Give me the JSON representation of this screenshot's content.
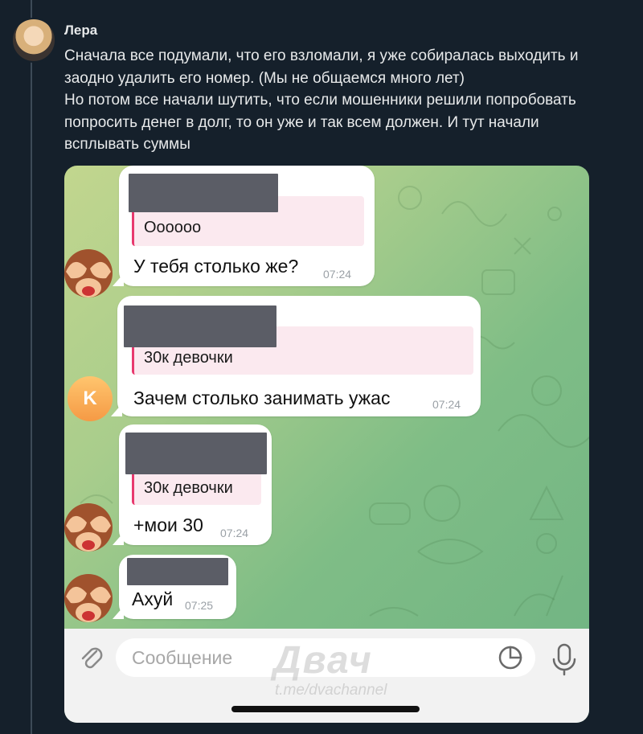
{
  "post": {
    "author": "Лера",
    "lines": [
      "Сначала все подумали, что его взломали, я уже собиралась выходить и",
      "заодно удалить его номер. (Мы не общаемся много лет)",
      "Но потом все начали шутить, что если мошенники решили попробовать",
      "попросить денег в долг, то он уже и так всем должен. И тут начали",
      "всплывать суммы"
    ]
  },
  "chat": {
    "messages": [
      {
        "quote": "Оооооо",
        "text": "У тебя столько же?",
        "time": "07:24",
        "avatar": "monkey-see-no-evil"
      },
      {
        "quote": "30к девочки",
        "text": "Зачем столько занимать ужас",
        "time": "07:24",
        "avatar": "K",
        "avatar_color": "#f7a54f"
      },
      {
        "quote": "30к девочки",
        "text": "+мои 30",
        "time": "07:24",
        "avatar": "monkey-see-no-evil"
      },
      {
        "quote": "",
        "text": "Ахуй",
        "time": "07:25",
        "avatar": "monkey-see-no-evil"
      }
    ],
    "input": {
      "placeholder": "Сообщение",
      "attach_icon": "paperclip-icon",
      "sticker_icon": "sticker-icon",
      "mic_icon": "microphone-icon"
    },
    "watermark": {
      "main": "Двач",
      "sub": "t.me/dvachannel"
    }
  },
  "colors": {
    "background": "#15202b",
    "quote_accent": "#e8396e",
    "chat_bg": "#a9cd8c"
  }
}
